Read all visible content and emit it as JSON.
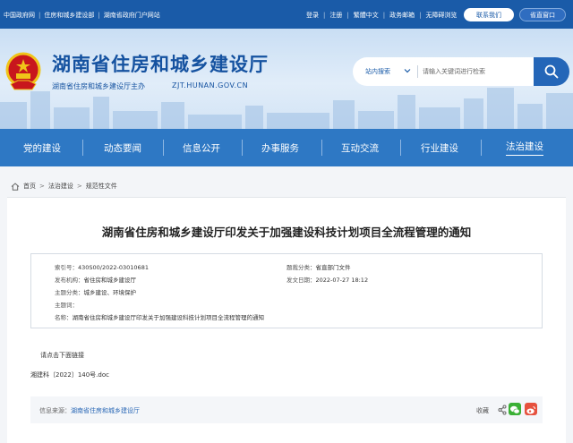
{
  "topbar": {
    "links": [
      "中国政府网",
      "住房和城乡建设部",
      "湖南省政府门户网站"
    ],
    "right_links": [
      "登录",
      "注册",
      "繁體中文",
      "政务邮箱",
      "无障碍浏览"
    ],
    "contact_label": "联系我们",
    "portal_label": "省直窗口"
  },
  "header": {
    "site_title": "湖南省住房和城乡建设厅",
    "sponsor": "湖南省住房和城乡建设厅主办",
    "domain": "ZJT.HUNAN.GOV.CN",
    "search": {
      "scope": "站内搜索",
      "placeholder": "请输入关键词进行检索"
    }
  },
  "nav": {
    "items": [
      "党的建设",
      "动态要闻",
      "信息公开",
      "办事服务",
      "互动交流",
      "行业建设",
      "法治建设"
    ],
    "active": "法治建设"
  },
  "breadcrumb": [
    "首页",
    "法治建设",
    "规范性文件"
  ],
  "article": {
    "title": "湖南省住房和城乡建设厅印发关于加强建设科技计划项目全流程管理的通知",
    "meta": {
      "index_label": "索引号：",
      "index_value": "430S00/2022-03010681",
      "category_label": "题裁分类：",
      "category_value": "省直部门文件",
      "issuer_label": "发布机构：",
      "issuer_value": "省住房和城乡建设厅",
      "date_label": "发文日期：",
      "date_value": "2022-07-27 18:12",
      "topic_label": "主题分类：",
      "topic_value": "城乡建设、环境保护",
      "keywords_label": "主题词：",
      "keywords_value": "",
      "name_label": "名称：",
      "name_value": "湖南省住房和城乡建设厅印发关于加强建设科技计划项目全流程管理的通知"
    },
    "download_hint": "请点击下面链接",
    "attachment": "湘建科〔2022〕140号.doc"
  },
  "footer_bar": {
    "source_label": "信息来源：",
    "source_value": "湖南省住房和城乡建设厅",
    "favorite": "收藏"
  },
  "colors": {
    "primary": "#1a5ba8",
    "nav": "#2e78c4",
    "emblem_red": "#c8161d",
    "emblem_gold": "#f0c419"
  }
}
